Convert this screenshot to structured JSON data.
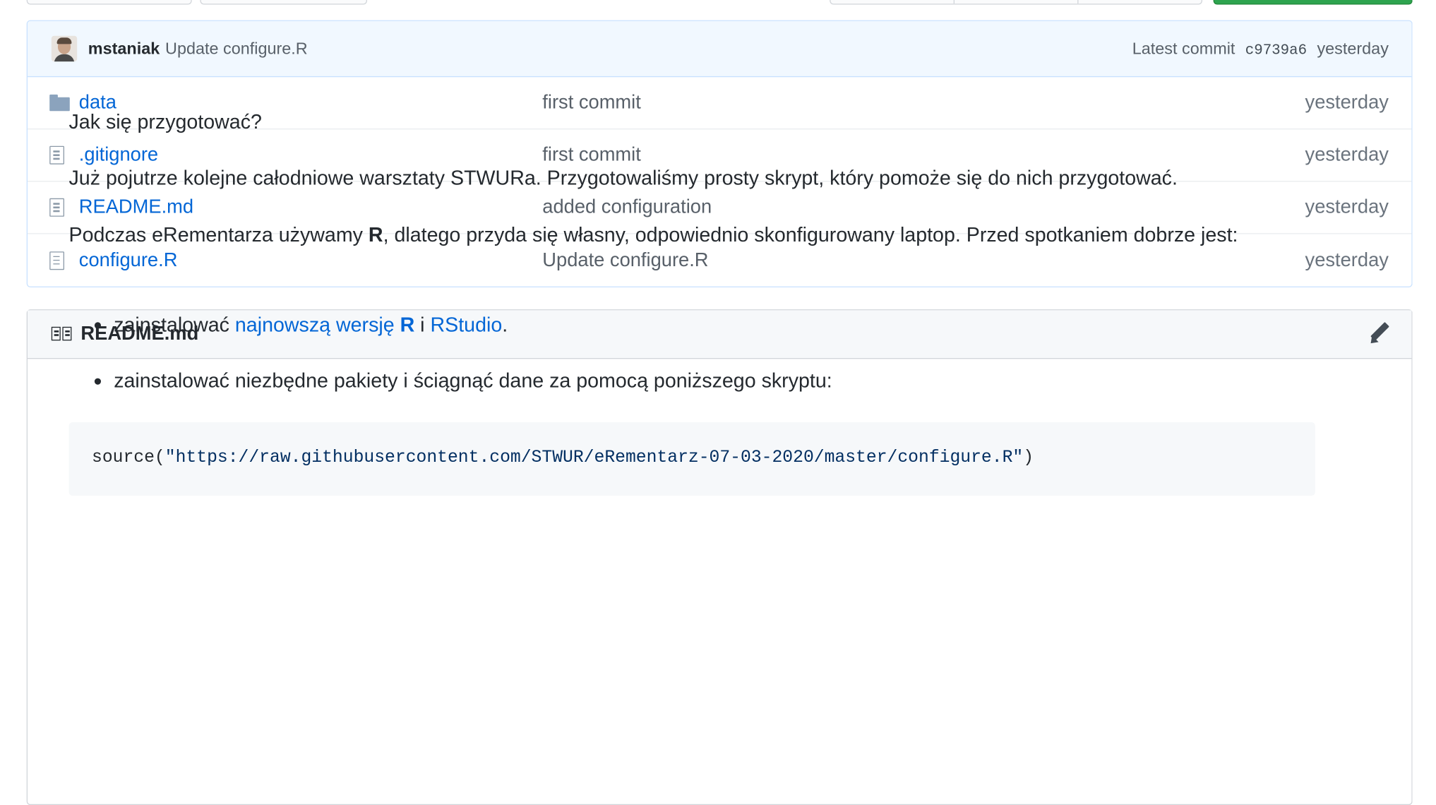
{
  "commit_bar": {
    "author": "mstaniak",
    "message": "Update configure.R",
    "latest_label": "Latest commit",
    "sha": "c9739a6",
    "age": "yesterday"
  },
  "files": [
    {
      "name": "data",
      "type": "folder",
      "commit": "first commit",
      "age": "yesterday"
    },
    {
      "name": ".gitignore",
      "type": "file",
      "commit": "first commit",
      "age": "yesterday"
    },
    {
      "name": "README.md",
      "type": "file",
      "commit": "added configuration",
      "age": "yesterday"
    },
    {
      "name": "configure.R",
      "type": "file",
      "commit": "Update configure.R",
      "age": "yesterday"
    }
  ],
  "readme": {
    "title": "README.md",
    "heading": "Jak się przygotować?",
    "p1": "Już pojutrze kolejne całodniowe warsztaty STWURa. Przygotowaliśmy prosty skrypt, który pomoże się do nich przygotować.",
    "p2_a": "Podczas eRementarza używamy ",
    "p2_b": "R",
    "p2_c": ", dlatego przyda się własny, odpowiednio skonfigurowany laptop. Przed spotkaniem dobrze jest:",
    "li1_a": "zainstalować ",
    "li1_link1": "najnowszą wersję ",
    "li1_link1_bold": "R",
    "li1_b": " i ",
    "li1_link2": "RStudio",
    "li1_c": ".",
    "li2": "zainstalować niezbędne pakiety i ściągnąć dane za pomocą poniższego skryptu:",
    "code_fn": "source(",
    "code_str": "\"https://raw.githubusercontent.com/STWUR/eRementarz-07-03-2020/master/configure.R\"",
    "code_end": ")"
  },
  "icons": {
    "folder": "folder-icon",
    "file": "file-icon",
    "readme": "book-icon",
    "edit": "pencil-icon"
  }
}
